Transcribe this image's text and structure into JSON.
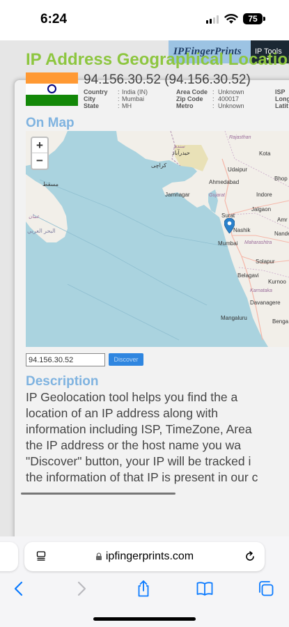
{
  "status": {
    "time": "6:24",
    "battery": "75"
  },
  "site": {
    "logo": "IPFingerPrints",
    "menu": "IP Tools"
  },
  "page": {
    "title": "IP Address Geographical Location",
    "ip_heading": "94.156.30.52 (94.156.30.52)",
    "info_col1": [
      {
        "label": "Country",
        "value": "India (IN)"
      },
      {
        "label": "City",
        "value": "Mumbai"
      },
      {
        "label": "State",
        "value": "MH"
      }
    ],
    "info_col2": [
      {
        "label": "Area Code",
        "value": "Unknown"
      },
      {
        "label": "Zip Code",
        "value": "400017"
      },
      {
        "label": "Metro",
        "value": "Unknown"
      }
    ],
    "info_col3": [
      "ISP",
      "Long",
      "Latit"
    ],
    "on_map": "On Map",
    "zoom_in": "+",
    "zoom_out": "−",
    "ip_input_value": "94.156.30.52",
    "discover_label": "Discover",
    "desc_title": "Description",
    "desc_lines": [
      "IP Geolocation tool helps you find the a",
      "location of an IP address along with",
      "information including ISP, TimeZone, Area",
      "the IP address or the host name you wa",
      "\"Discover\" button, your IP will be tracked i",
      "the information of that IP is present in our c"
    ]
  },
  "map_labels": {
    "rajasthan": "Rajasthan",
    "kota": "Kota",
    "udaipur": "Udaipur",
    "ahmedabad": "Ahmedabad",
    "gujarat": "Gujarat",
    "jamnagar": "Jamnagar",
    "indore": "Indore",
    "bhop": "Bhop",
    "jalgaon": "Jalgaon",
    "surat": "Surat",
    "amr": "Amr",
    "nashik": "Nashik",
    "nande": "Nande",
    "mumbai": "Mumbai",
    "maharashtra": "Maharashtra",
    "solapur": "Solapur",
    "belagavi": "Belagavi",
    "kurnoo": "Kurnoo",
    "karnataka": "Karnataka",
    "davanagere": "Davanagere",
    "mangaluru": "Mangaluru",
    "benga": "Benga",
    "karachi": "کراچی",
    "hyderabad_pk": "حیدرآباد",
    "sindh": "سندھ",
    "muscat": "مسقط",
    "oman": "عمان",
    "arabian": "البحر العربي"
  },
  "browser": {
    "url": "ipfingerprints.com"
  },
  "colors": {
    "title_green": "#8dc63f",
    "section_blue": "#7fb3e0",
    "sea": "#aad3df",
    "land": "#f2efe9",
    "ios_blue": "#0a7aff"
  },
  "icons": [
    "signal-icon",
    "wifi-icon",
    "battery-icon",
    "map-pin-icon",
    "lock-icon",
    "reader-icon",
    "reload-icon",
    "back-icon",
    "forward-icon",
    "share-icon",
    "bookmarks-icon",
    "tabs-icon"
  ]
}
